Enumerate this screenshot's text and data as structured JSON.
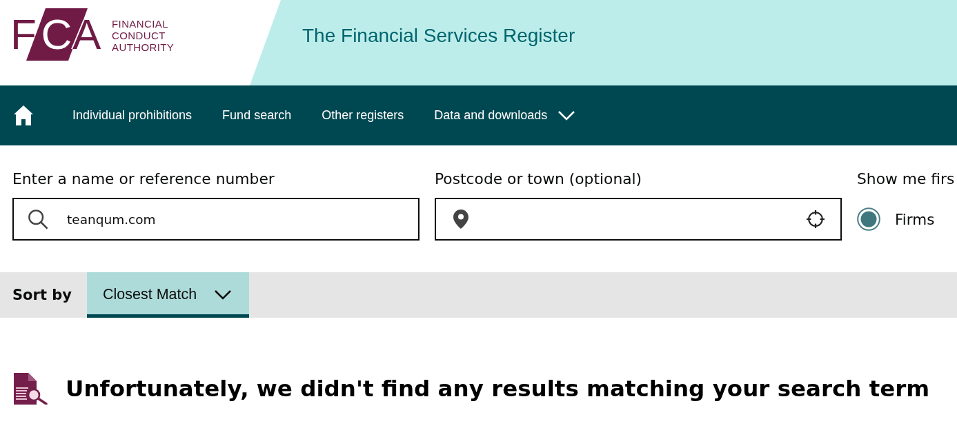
{
  "header": {
    "logo": {
      "letters": "FCA",
      "wordmark": [
        "FINANCIAL",
        "CONDUCT",
        "AUTHORITY"
      ]
    },
    "title": "The Financial Services Register"
  },
  "nav": {
    "items": [
      {
        "kind": "home"
      },
      {
        "kind": "link",
        "label": "Individual prohibitions"
      },
      {
        "kind": "link",
        "label": "Fund search"
      },
      {
        "kind": "link",
        "label": "Other registers"
      },
      {
        "kind": "dropdown",
        "label": "Data and downloads"
      }
    ]
  },
  "search": {
    "fields": [
      {
        "kind": "search",
        "label": "Enter a name or reference number",
        "value": "teanqum.com"
      },
      {
        "kind": "location",
        "label": "Postcode or town (optional)"
      }
    ],
    "show_first": {
      "label": "Show me firs",
      "options": [
        {
          "label": "Firms",
          "selected": true
        }
      ]
    }
  },
  "sort": {
    "label": "Sort by",
    "value": "Closest Match"
  },
  "message": "Unfortunately, we didn't find any results matching your search term"
}
